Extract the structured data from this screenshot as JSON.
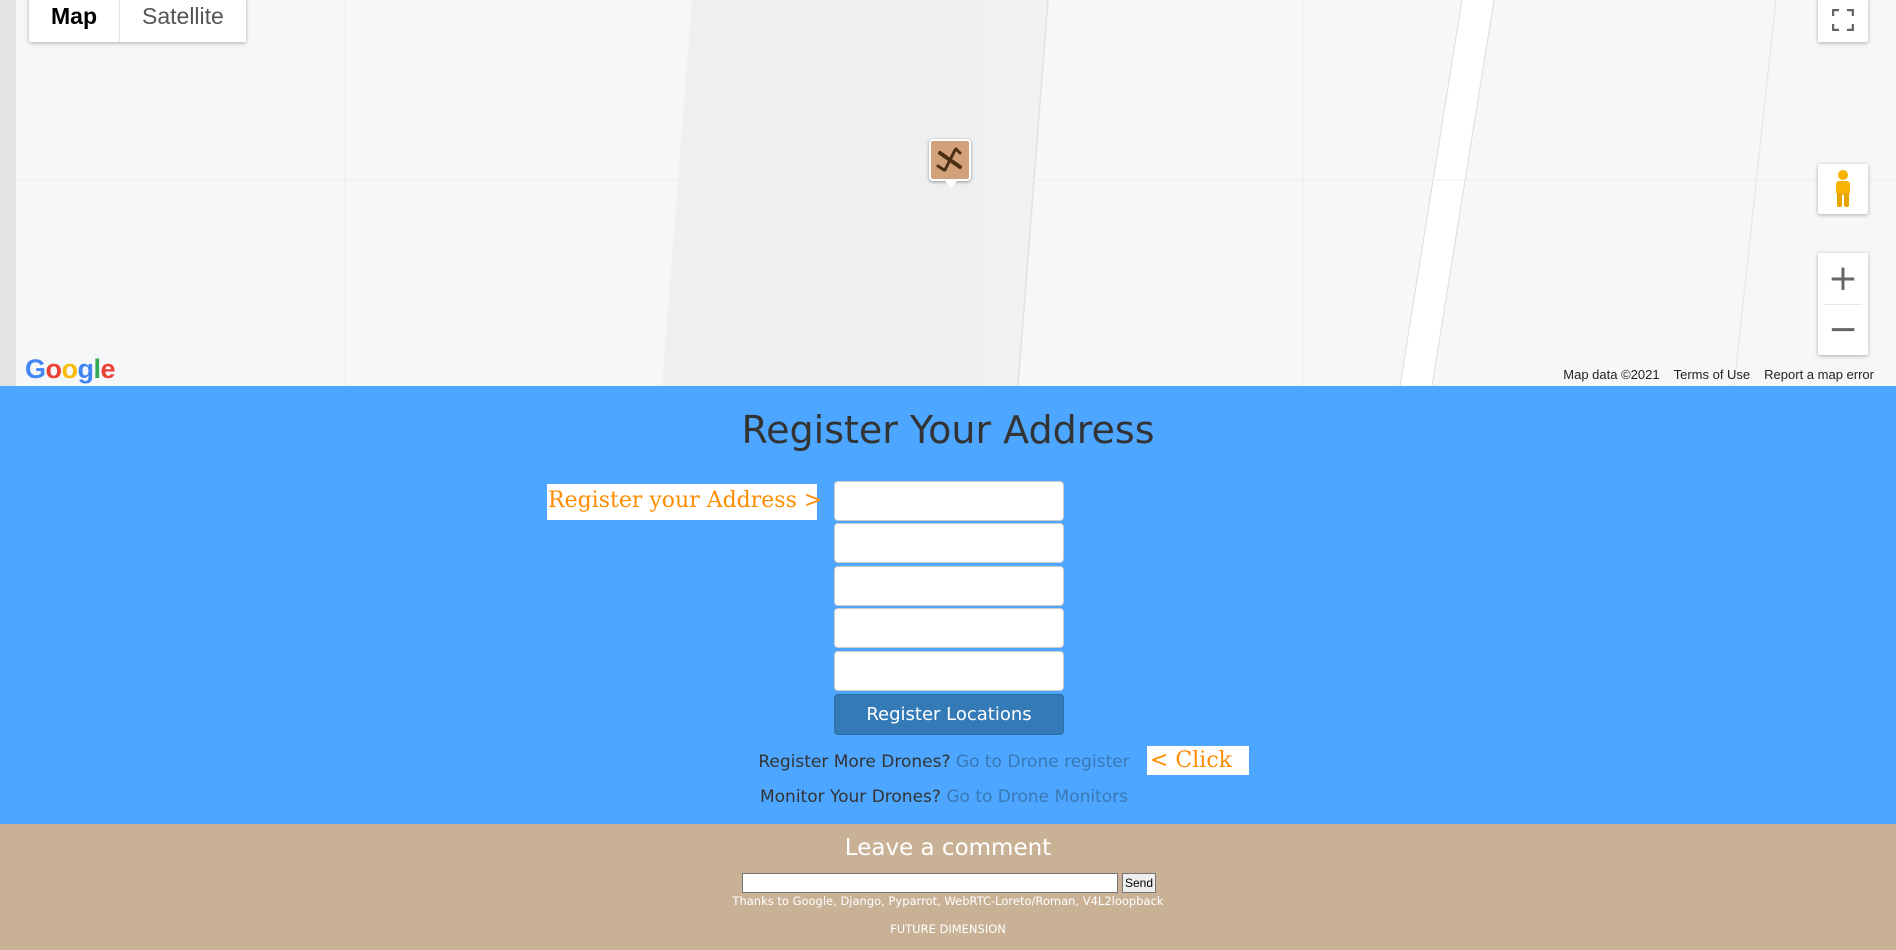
{
  "map": {
    "type_options": [
      {
        "label": "Map",
        "active": true
      },
      {
        "label": "Satellite",
        "active": false
      }
    ],
    "controls": {
      "fullscreen_icon": "fullscreen-icon",
      "pegman_icon": "street-view-pegman-icon",
      "zoom_in": "+",
      "zoom_out": "−"
    },
    "marker_icon": "drone-marker-icon",
    "logo": "Google",
    "attribution": {
      "map_data": "Map data ©2021",
      "terms": "Terms of Use",
      "report": "Report a map error"
    }
  },
  "register": {
    "title": "Register Your Address",
    "callout_left": "Register  your  Address  >",
    "fields": [
      {
        "value": "",
        "placeholder": ""
      },
      {
        "value": "",
        "placeholder": ""
      },
      {
        "value": "",
        "placeholder": ""
      },
      {
        "value": "",
        "placeholder": ""
      },
      {
        "value": "",
        "placeholder": ""
      }
    ],
    "submit_label": "Register Locations",
    "more_drones_text": "Register More Drones?",
    "more_drones_link": "Go to Drone register",
    "callout_right": "<  Click",
    "monitor_text": "Monitor Your Drones?",
    "monitor_link": "Go to Drone Monitors"
  },
  "footer": {
    "title": "Leave a comment",
    "comment_value": "",
    "send_label": "Send",
    "thanks": "Thanks to Google, Django, Pyparrot, WebRTC-Loreto/Roman, V4L2loopback",
    "brand": "FUTURE DIMENSION"
  },
  "colors": {
    "register_bg": "#4da6ff",
    "footer_bg": "#c9b196",
    "button_bg": "#337ab7",
    "callout_text": "#ff8c00",
    "link": "#3a78b5"
  }
}
